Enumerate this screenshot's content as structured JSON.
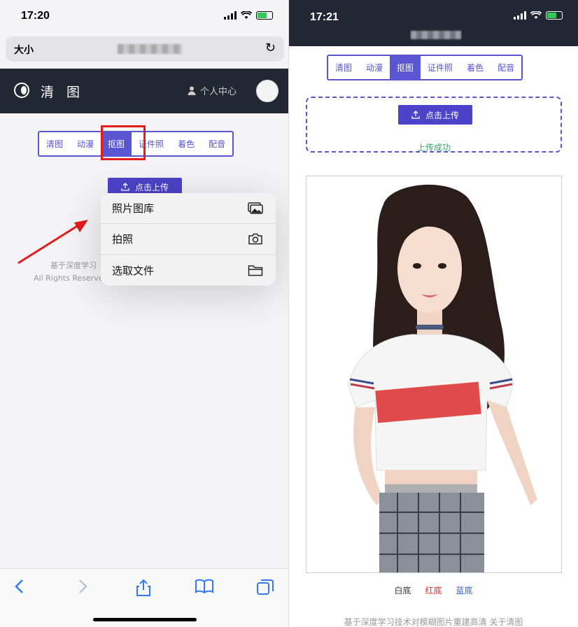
{
  "left": {
    "status": {
      "time": "17:20"
    },
    "urlbar": {
      "text_size_label": "大小"
    },
    "site": {
      "brand": "清 图",
      "user_center": "个人中心"
    },
    "tabs": [
      "清图",
      "动漫",
      "抠图",
      "证件照",
      "着色",
      "配音"
    ],
    "active_tab_index": 2,
    "upload_label": "点击上传",
    "footer_line1": "基于深度学习",
    "footer_line2": "All Rights Reserve",
    "menu": [
      {
        "label": "照片图库",
        "icon": "photo-library-icon"
      },
      {
        "label": "拍照",
        "icon": "camera-icon"
      },
      {
        "label": "选取文件",
        "icon": "folder-icon"
      }
    ]
  },
  "right": {
    "status": {
      "time": "17:21"
    },
    "tabs": [
      "清图",
      "动漫",
      "抠图",
      "证件照",
      "着色",
      "配音"
    ],
    "active_tab_index": 2,
    "upload_label": "点击上传",
    "upload_status": "上传成功",
    "bg_options": [
      {
        "label": "白底",
        "color": "#333333"
      },
      {
        "label": "红底",
        "color": "#e02a2a"
      },
      {
        "label": "蓝底",
        "color": "#2a64c8"
      }
    ],
    "footer": "基于深度学习技术对模糊图片重建高清   关于清图"
  },
  "colors": {
    "accent": "#5a55d0",
    "header_bg": "#222833",
    "annotation_red": "#e21b1b",
    "ios_blue": "#3478f6"
  }
}
